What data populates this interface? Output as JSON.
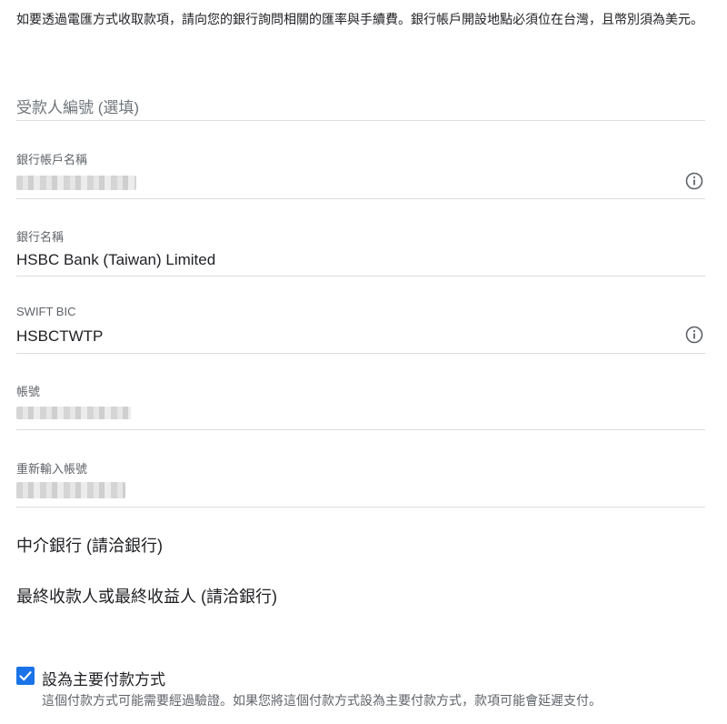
{
  "intro_text": "如要透過電匯方式收取款項，請向您的銀行詢問相關的匯率與手續費。銀行帳戶開設地點必須位在台灣，且幣別須為美元。",
  "fields": {
    "payee_id": {
      "placeholder": "受款人編號 (選填)"
    },
    "account_name": {
      "label": "銀行帳戶名稱",
      "value": ""
    },
    "bank_name": {
      "label": "銀行名稱",
      "value": "HSBC Bank (Taiwan) Limited"
    },
    "swift": {
      "label": "SWIFT BIC",
      "value": "HSBCTWTP"
    },
    "account_number": {
      "label": "帳號",
      "value": ""
    },
    "account_number_confirm": {
      "label": "重新輸入帳號",
      "value": ""
    }
  },
  "sections": {
    "intermediary": "中介銀行 (請洽銀行)",
    "final_beneficiary": "最終收款人或最終收益人 (請洽銀行)"
  },
  "primary_checkbox": {
    "checked": true,
    "label": "設為主要付款方式",
    "description": "這個付款方式可能需要經過驗證。如果您將這個付款方式設為主要付款方式，款項可能會延遲支付。"
  },
  "icons": {
    "info": "info-circle-icon",
    "check": "check-icon"
  },
  "colors": {
    "accent": "#1a73e8",
    "divider": "#dadce0",
    "label": "#5f6368"
  }
}
